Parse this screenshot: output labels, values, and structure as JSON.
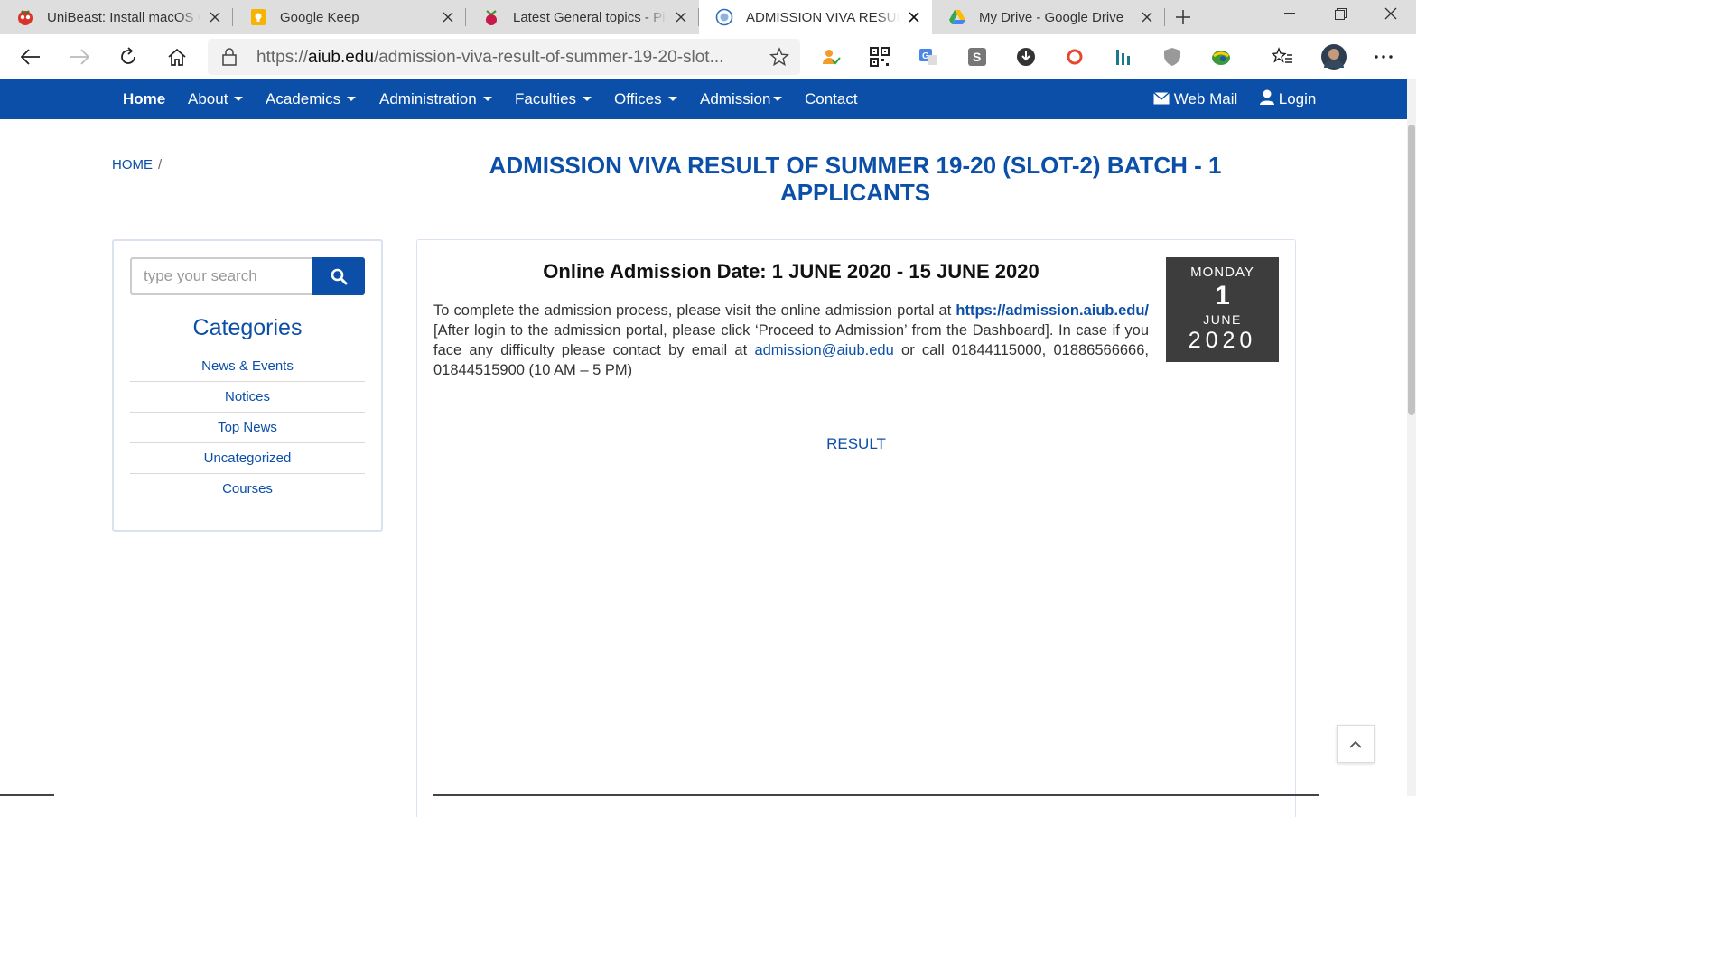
{
  "browser": {
    "tabs": [
      {
        "title": "UniBeast: Install macOS Cat",
        "favicon": "tonymac-icon"
      },
      {
        "title": "Google Keep",
        "favicon": "keep-icon"
      },
      {
        "title": "Latest General topics - Pi-h",
        "favicon": "raspberry-icon"
      },
      {
        "title": "ADMISSION VIVA RESULT O",
        "favicon": "aiub-icon",
        "active": true
      },
      {
        "title": "My Drive - Google Drive",
        "favicon": "drive-icon"
      }
    ],
    "address": {
      "scheme": "https://",
      "host": "aiub.edu",
      "path": "/admission-viva-result-of-summer-19-20-slot..."
    }
  },
  "site_nav": {
    "home": "Home",
    "about": "About",
    "academics": "Academics",
    "administration": "Administration",
    "faculties": "Faculties",
    "offices": "Offices",
    "admission": "Admission",
    "contact": "Contact",
    "webmail": "Web Mail",
    "login": "Login"
  },
  "breadcrumb": {
    "home": "HOME",
    "sep": "/"
  },
  "page": {
    "title": "ADMISSION VIVA RESULT OF SUMMER 19-20 (SLOT-2) BATCH - 1 APPLICANTS"
  },
  "sidebar": {
    "search_placeholder": "type your search",
    "categories_title": "Categories",
    "categories": [
      "News & Events",
      "Notices",
      "Top News",
      "Uncategorized",
      "Courses"
    ]
  },
  "post": {
    "heading": "Online Admission Date: 1 JUNE 2020 - 15 JUNE 2020",
    "para_1": "To complete the admission process, please visit the online admission portal at ",
    "portal_link": "https://admission.aiub.edu/",
    "para_2": "  [After login to the admission portal, please click ‘Proceed to Admission’ from the Dashboard]. In case if you face any difficulty please contact by email at ",
    "email_link": "admission@aiub.edu",
    "para_3": " or call 01844115000, 01886566666, 01844515900 (10 AM – 5 PM)",
    "result_link": "RESULT"
  },
  "date_badge": {
    "weekday": "MONDAY",
    "day": "1",
    "month": "JUNE",
    "year": "2020"
  },
  "colors": {
    "brand_blue": "#0b4fa8",
    "date_bg": "#3d3d3d"
  }
}
